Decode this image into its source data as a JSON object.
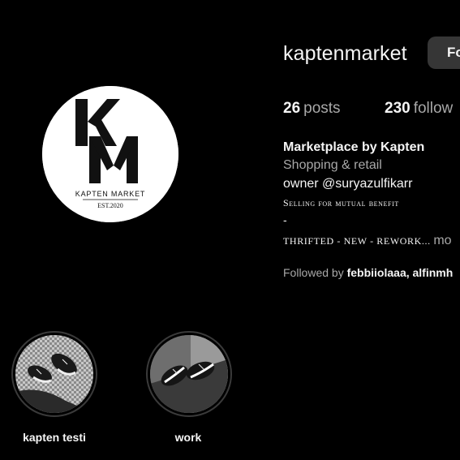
{
  "profile": {
    "username": "kaptenmarket",
    "follow_label": "Fo",
    "logo_text": "KAPTEN MARKET",
    "logo_est": "EST.2020",
    "logo_monogram_top": "K",
    "logo_monogram_bottom": "M"
  },
  "stats": {
    "posts_count": "26",
    "posts_label": "posts",
    "followers_count": "230",
    "followers_label": "follow"
  },
  "bio": {
    "name": "Marketplace by Kapten",
    "category": "Shopping & retail",
    "owner": "owner @suryazulfikarr",
    "selling": "Selling for mutual benefit",
    "dash": "-",
    "line3": "thrifted - new - rework...",
    "more": "mo"
  },
  "followed_by": {
    "prefix": "Followed by",
    "names": "febbiiolaaa, alfinmh"
  },
  "highlights": [
    {
      "label": "kapten testi"
    },
    {
      "label": "work"
    }
  ],
  "colors": {
    "background": "#000000",
    "text_primary": "#f5f5f5",
    "text_secondary": "#a8a8a8",
    "button_bg": "#363636"
  }
}
